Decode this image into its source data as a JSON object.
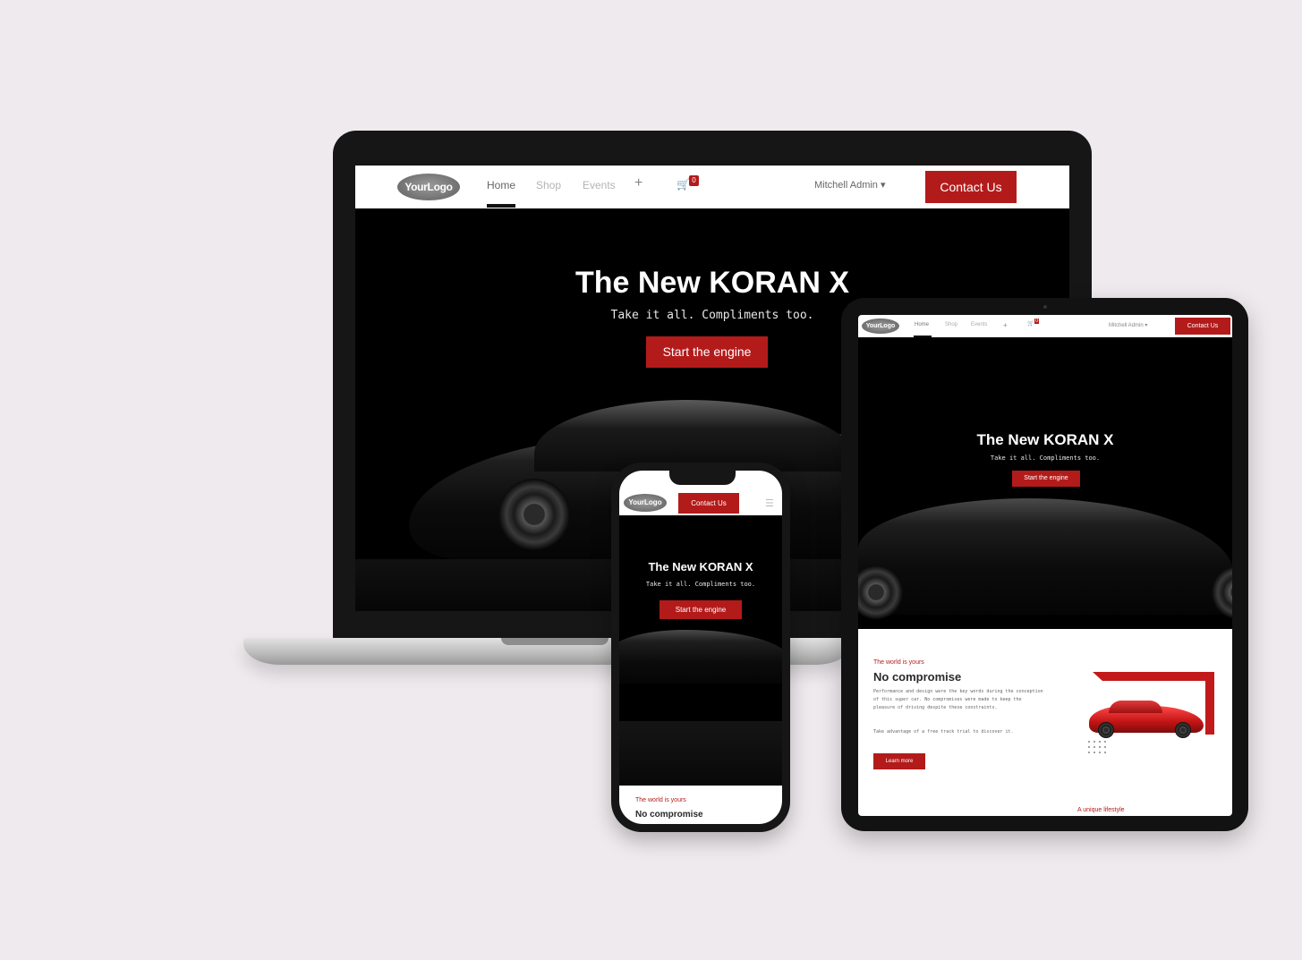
{
  "brand": {
    "logo_text": "YourLogo",
    "accent_color": "#b31b1b",
    "background_color": "#efeaee"
  },
  "nav": {
    "home": "Home",
    "shop": "Shop",
    "events": "Events",
    "plus_icon": "plus-icon",
    "cart_icon": "cart-icon",
    "cart_count": "0",
    "user": "Mitchell Admin",
    "contact_button": "Contact Us"
  },
  "hero": {
    "title": "The New KORAN X",
    "subtitle": "Take it all. Compliments too.",
    "cta": "Start the engine"
  },
  "tablet": {
    "section_eyebrow": "The world is yours",
    "section_title": "No compromise",
    "paragraph_1": "Performance and design were the key words during the conception of this super car. No compromises were made to keep the pleasure of driving despite these constraints.",
    "paragraph_2": "Take advantage of a free track trial to discover it.",
    "learn_more": "Learn more",
    "next_section_title": "A unique lifestyle"
  },
  "phone": {
    "section_eyebrow": "The world is yours",
    "section_title": "No compromise",
    "menu_icon": "hamburger-icon"
  }
}
